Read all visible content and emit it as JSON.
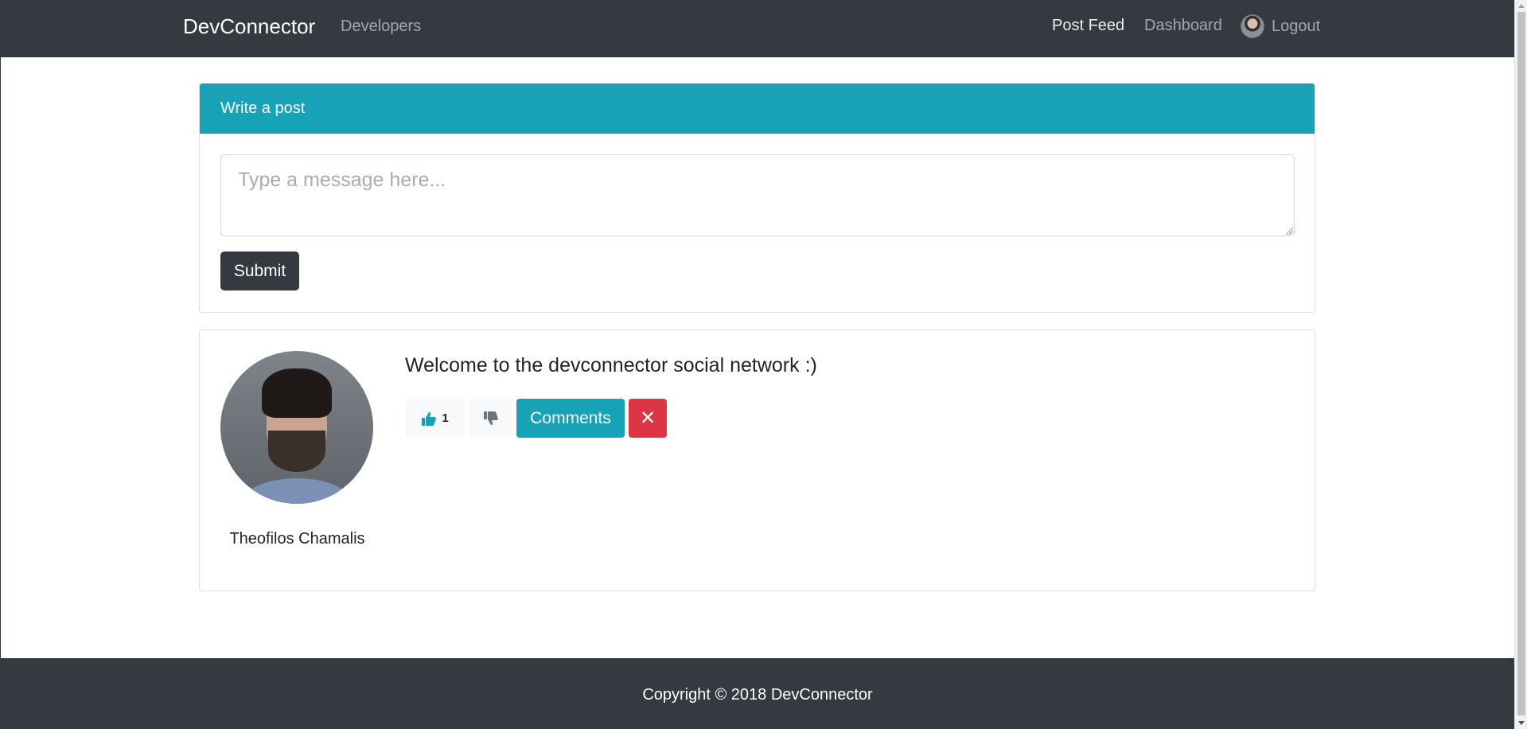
{
  "navbar": {
    "brand": "DevConnector",
    "developers": "Developers",
    "post_feed": "Post Feed",
    "dashboard": "Dashboard",
    "logout": "Logout"
  },
  "post_form": {
    "header": "Write a post",
    "placeholder": "Type a message here...",
    "submit_label": "Submit"
  },
  "post": {
    "author_name": "Theofilos Chamalis",
    "text": "Welcome to the devconnector social network :)",
    "like_count": "1",
    "comments_label": "Comments",
    "delete_glyph": "✕"
  },
  "footer": {
    "copyright": "Copyright © 2018 DevConnector"
  },
  "icons": {
    "like": "thumbs-up-icon",
    "dislike": "thumbs-down-icon",
    "delete": "close-icon"
  },
  "colors": {
    "navbar": "#343a40",
    "info": "#17a2b8",
    "danger": "#dc3545",
    "dark": "#343a40",
    "light": "#f8f9fa"
  }
}
